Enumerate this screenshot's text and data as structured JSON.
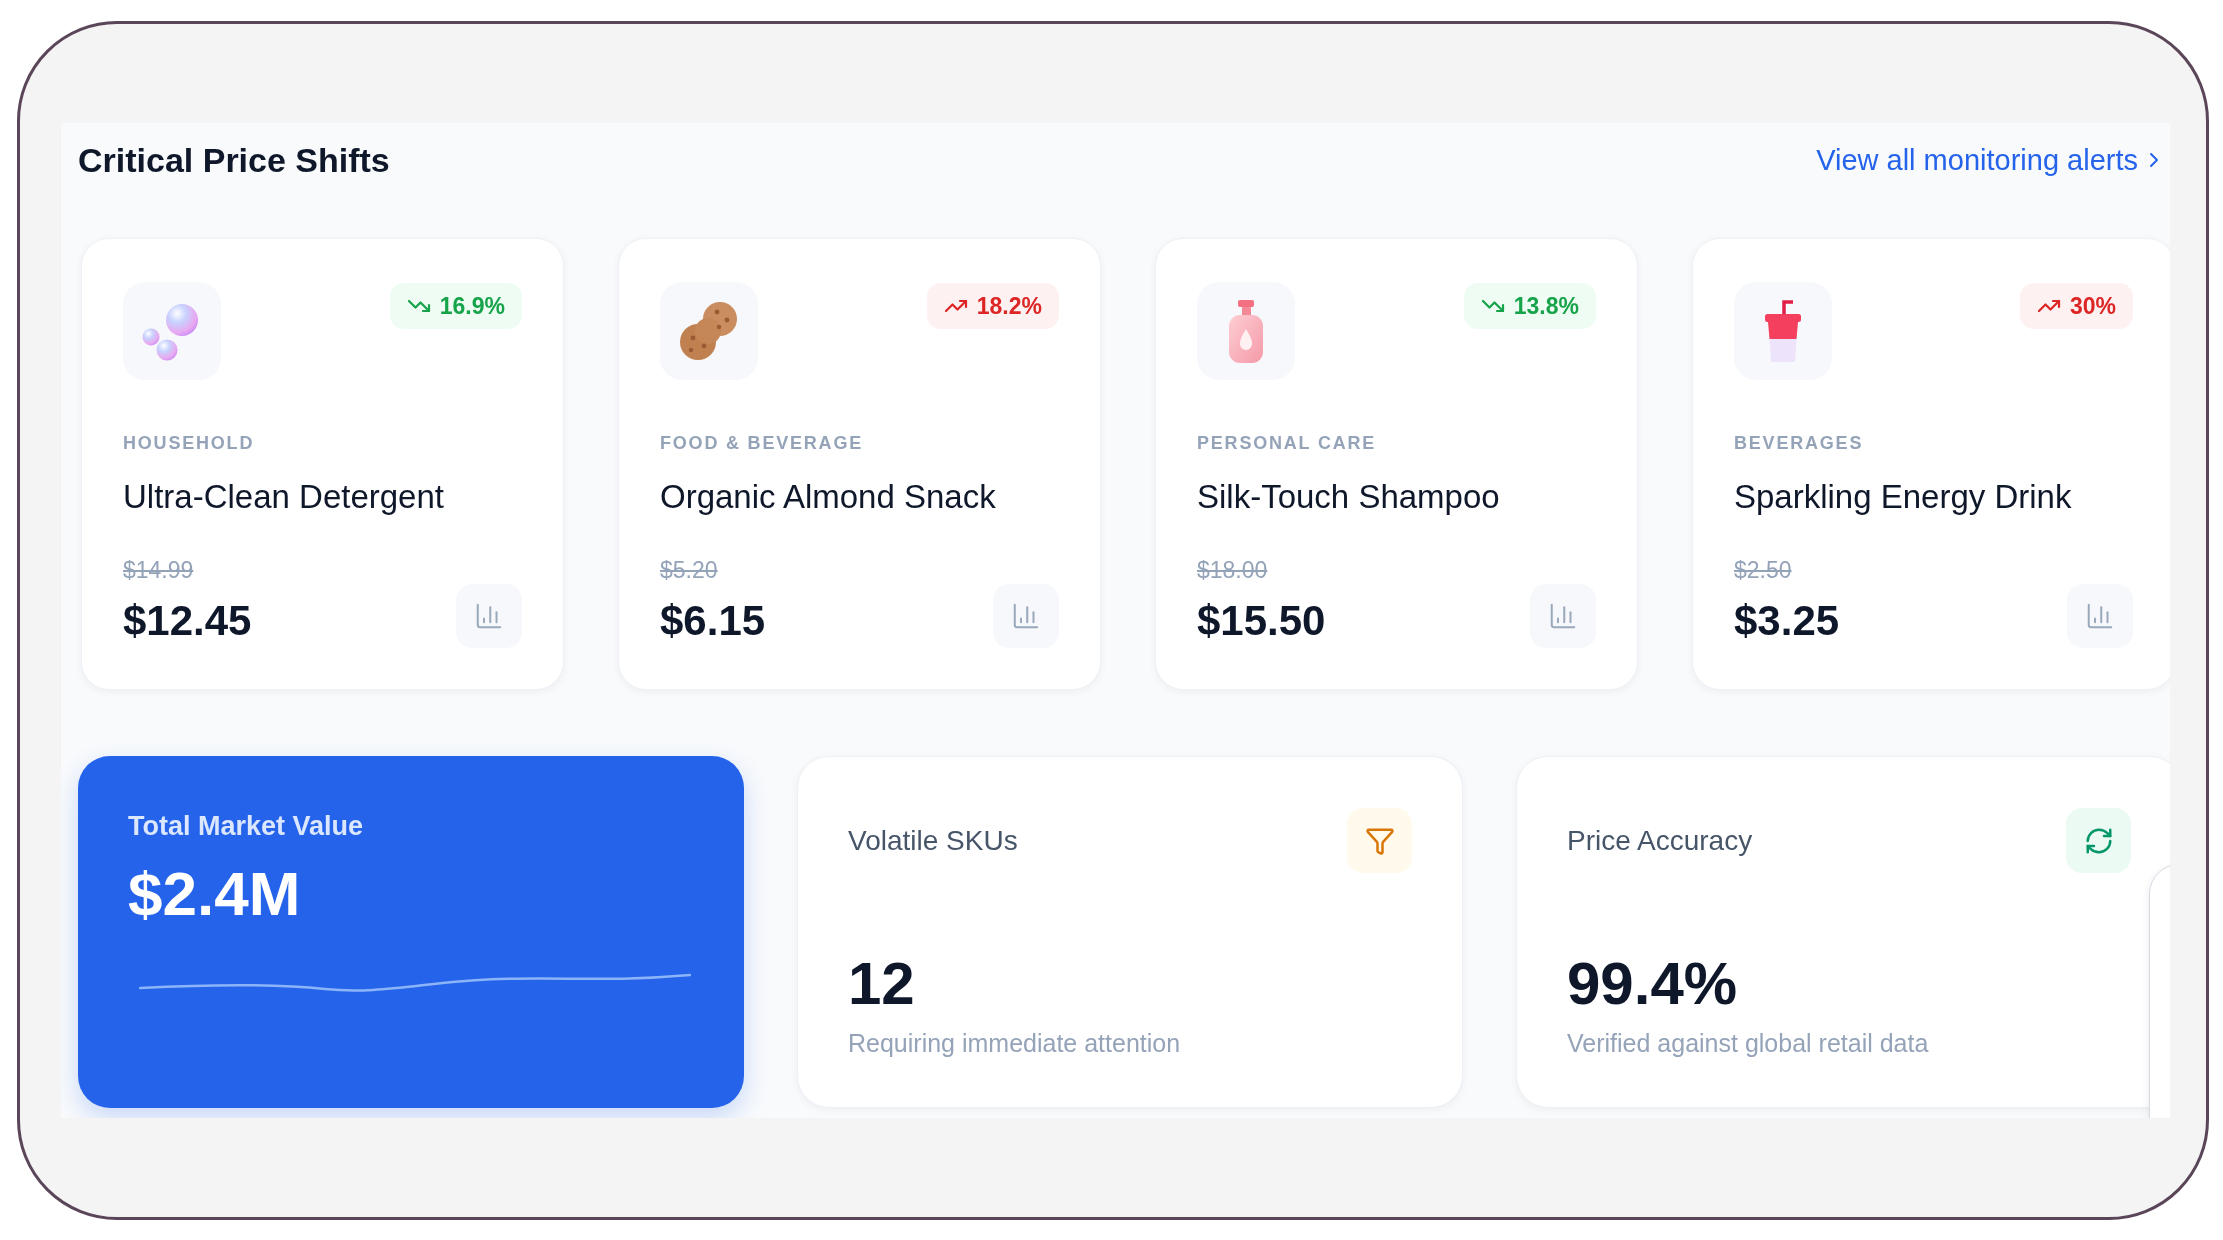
{
  "section": {
    "title": "Critical Price Shifts",
    "link": "View all monitoring alerts"
  },
  "products": [
    {
      "category": "HOUSEHOLD",
      "name": "Ultra-Clean Detergent",
      "old_price": "$14.99",
      "price": "$12.45",
      "change": "16.9%",
      "rising": false
    },
    {
      "category": "FOOD & BEVERAGE",
      "name": "Organic Almond Snack",
      "old_price": "$5.20",
      "price": "$6.15",
      "change": "18.2%",
      "rising": true
    },
    {
      "category": "PERSONAL CARE",
      "name": "Silk-Touch Shampoo",
      "old_price": "$18.00",
      "price": "$15.50",
      "change": "13.8%",
      "rising": false
    },
    {
      "category": "BEVERAGES",
      "name": "Sparkling Energy Drink",
      "old_price": "$2.50",
      "price": "$3.25",
      "change": "30%",
      "rising": true
    }
  ],
  "stats": [
    {
      "kind": "highlight",
      "label": "Total Market Value",
      "value": "$2.4M"
    },
    {
      "kind": "metric",
      "label": "Volatile SKUs",
      "value": "12",
      "note": "Requiring immediate attention"
    },
    {
      "kind": "metric",
      "label": "Price Accuracy",
      "value": "99.4%",
      "note": "Verified against global retail data"
    }
  ]
}
